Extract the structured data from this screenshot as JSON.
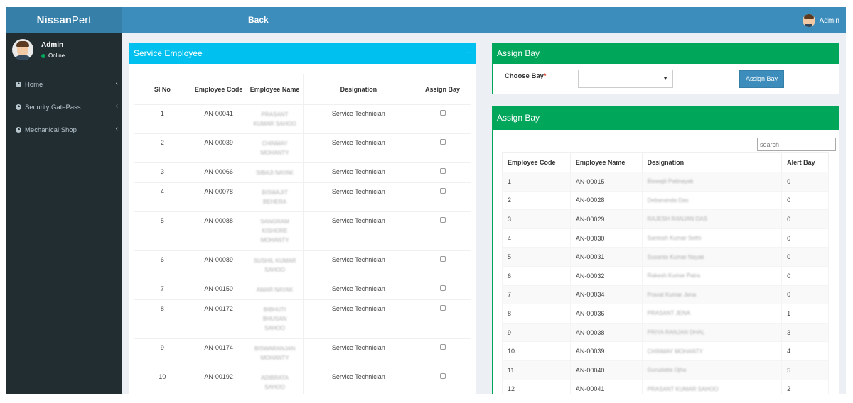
{
  "brand": {
    "bold": "Nissan",
    "light": "Pert"
  },
  "header": {
    "back_label": "Back",
    "user_name": "Admin"
  },
  "sidebar": {
    "user_name": "Admin",
    "status": "Online",
    "items": [
      {
        "label": "Home"
      },
      {
        "label": "Security GatePass"
      },
      {
        "label": "Mechanical Shop"
      }
    ]
  },
  "service_panel": {
    "title": "Service Employee",
    "collapse_glyph": "–",
    "columns": [
      "Sl No",
      "Employee Code",
      "Employee Name",
      "Designation",
      "Assign Bay"
    ],
    "rows": [
      {
        "sl": "1",
        "code": "AN-00041",
        "name": [
          "PRASANT",
          "KUMAR SAHOO"
        ],
        "designation": "Service Technician",
        "h": 41
      },
      {
        "sl": "2",
        "code": "AN-00039",
        "name": [
          "CHINMAY",
          "MOHANTY"
        ],
        "designation": "Service Technician",
        "h": 41
      },
      {
        "sl": "3",
        "code": "AN-00066",
        "name": [
          "SIBAJI NAYAK"
        ],
        "designation": "Service Technician",
        "h": 28
      },
      {
        "sl": "4",
        "code": "AN-00078",
        "name": [
          "BISWAJIT",
          "BEHERA"
        ],
        "designation": "Service Technician",
        "h": 41
      },
      {
        "sl": "5",
        "code": "AN-00088",
        "name": [
          "SANGRAM",
          "KISHORE",
          "MOHANTY"
        ],
        "designation": "Service Technician",
        "h": 55
      },
      {
        "sl": "6",
        "code": "AN-00089",
        "name": [
          "SUSHIL KUMAR",
          "SAHOO"
        ],
        "designation": "Service Technician",
        "h": 41
      },
      {
        "sl": "7",
        "code": "AN-00150",
        "name": [
          "AMAR NAYAK"
        ],
        "designation": "Service Technician",
        "h": 28
      },
      {
        "sl": "8",
        "code": "AN-00172",
        "name": [
          "BIBHUTI",
          "BHUSAN",
          "SAHOO"
        ],
        "designation": "Service Technician",
        "h": 55
      },
      {
        "sl": "9",
        "code": "AN-00174",
        "name": [
          "BISWARANJAN",
          "MOHANTY"
        ],
        "designation": "Service Technician",
        "h": 41
      },
      {
        "sl": "10",
        "code": "AN-00192",
        "name": [
          "ADIBRATA",
          "SAHOO"
        ],
        "designation": "Service Technician",
        "h": 41
      }
    ]
  },
  "assign_form": {
    "title": "Assign Bay",
    "choose_label": "Choose Bay",
    "required_mark": "*",
    "selected_value": "",
    "dropdown_arrow": "▼",
    "button_label": "Assign Bay"
  },
  "alert_panel": {
    "title": "Assign Bay",
    "search_placeholder": "search",
    "columns": [
      "Employee Code",
      "Employee Name",
      "Designation",
      "Alert Bay"
    ],
    "rows": [
      {
        "c1": "1",
        "c2": "AN-00015",
        "c3": "Biswajit Pattnayak",
        "c4": "0"
      },
      {
        "c1": "2",
        "c2": "AN-00028",
        "c3": "Debananda Das",
        "c4": "0"
      },
      {
        "c1": "3",
        "c2": "AN-00029",
        "c3": "RAJESH RANJAN DAS",
        "c4": "0"
      },
      {
        "c1": "4",
        "c2": "AN-00030",
        "c3": "Santosh Kumar Sethi",
        "c4": "0"
      },
      {
        "c1": "5",
        "c2": "AN-00031",
        "c3": "Susanta Kumar Nayak",
        "c4": "0"
      },
      {
        "c1": "6",
        "c2": "AN-00032",
        "c3": "Rakesh Kumar Patra",
        "c4": "0"
      },
      {
        "c1": "7",
        "c2": "AN-00034",
        "c3": "Pravat Kumar Jena",
        "c4": "0"
      },
      {
        "c1": "8",
        "c2": "AN-00036",
        "c3": "PRASANT JENA",
        "c4": "1"
      },
      {
        "c1": "9",
        "c2": "AN-00038",
        "c3": "PRIYA RANJAN DHAL",
        "c4": "3"
      },
      {
        "c1": "10",
        "c2": "AN-00039",
        "c3": "CHINMAY MOHANTY",
        "c4": "4"
      },
      {
        "c1": "11",
        "c2": "AN-00040",
        "c3": "Gurudatta Ojha",
        "c4": "5"
      },
      {
        "c1": "12",
        "c2": "AN-00041",
        "c3": "PRASANT KUMAR SAHOO",
        "c4": "2"
      }
    ]
  }
}
